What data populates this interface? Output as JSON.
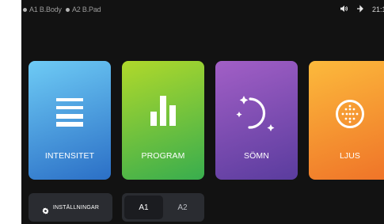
{
  "statusbar": {
    "devices": [
      {
        "label": "A1 B.Body"
      },
      {
        "label": "A2 B.Pad"
      }
    ],
    "time": "21:1",
    "icons": [
      "volume-icon",
      "bluetooth-icon"
    ]
  },
  "tiles": [
    {
      "label": "INTENSITET",
      "icon": "menu-lines-icon",
      "color_top": "#66c4f2",
      "color_bottom": "#2a73c8"
    },
    {
      "label": "PROGRAM",
      "icon": "bar-chart-icon",
      "color_top": "#a8d630",
      "color_bottom": "#3fb04a"
    },
    {
      "label": "SÖMN",
      "icon": "moon-stars-icon",
      "color_top": "#9b5cc4",
      "color_bottom": "#5b3ea0"
    },
    {
      "label": "LJUS",
      "icon": "light-grid-icon",
      "color_top": "#fbb53a",
      "color_bottom": "#f0782a"
    }
  ],
  "bottom": {
    "settings_label": "INSTÄLLNINGAR",
    "segments": [
      {
        "label": "A1",
        "selected": true
      },
      {
        "label": "A2",
        "selected": false
      }
    ]
  }
}
